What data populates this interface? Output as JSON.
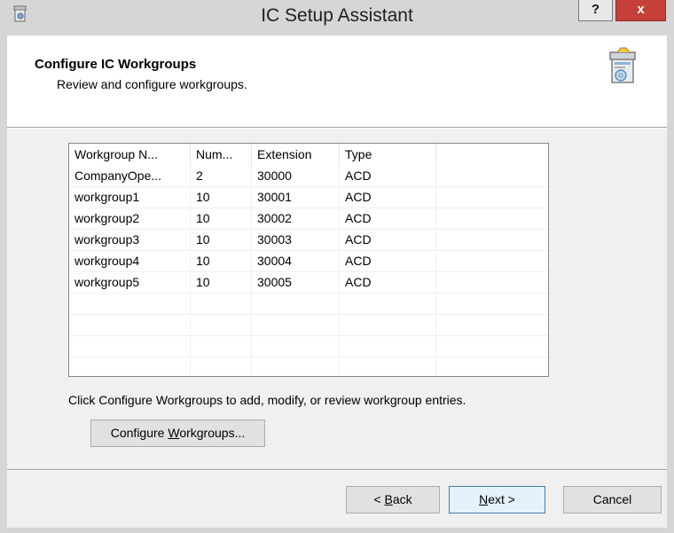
{
  "window": {
    "title": "IC Setup Assistant",
    "help_label": "?",
    "close_label": "x",
    "colors": {
      "close": "#c6403a",
      "titlebar": "#d6d6d6"
    }
  },
  "header": {
    "title": "Configure IC Workgroups",
    "subtitle": "Review and configure workgroups."
  },
  "table": {
    "columns": [
      "Workgroup N...",
      "Num...",
      "Extension",
      "Type"
    ],
    "rows": [
      [
        "CompanyOpe...",
        "2",
        "30000",
        "ACD"
      ],
      [
        "workgroup1",
        "10",
        "30001",
        "ACD"
      ],
      [
        "workgroup2",
        "10",
        "30002",
        "ACD"
      ],
      [
        "workgroup3",
        "10",
        "30003",
        "ACD"
      ],
      [
        "workgroup4",
        "10",
        "30004",
        "ACD"
      ],
      [
        "workgroup5",
        "10",
        "30005",
        "ACD"
      ]
    ]
  },
  "instruction": "Click Configure Workgroups to add, modify, or review workgroup entries.",
  "buttons": {
    "configure_pre": "Configure ",
    "configure_ul": "W",
    "configure_post": "orkgroups...",
    "back_pre": "< ",
    "back_ul": "B",
    "back_post": "ack",
    "next_ul": "N",
    "next_post": "ext >",
    "cancel": "Cancel"
  }
}
